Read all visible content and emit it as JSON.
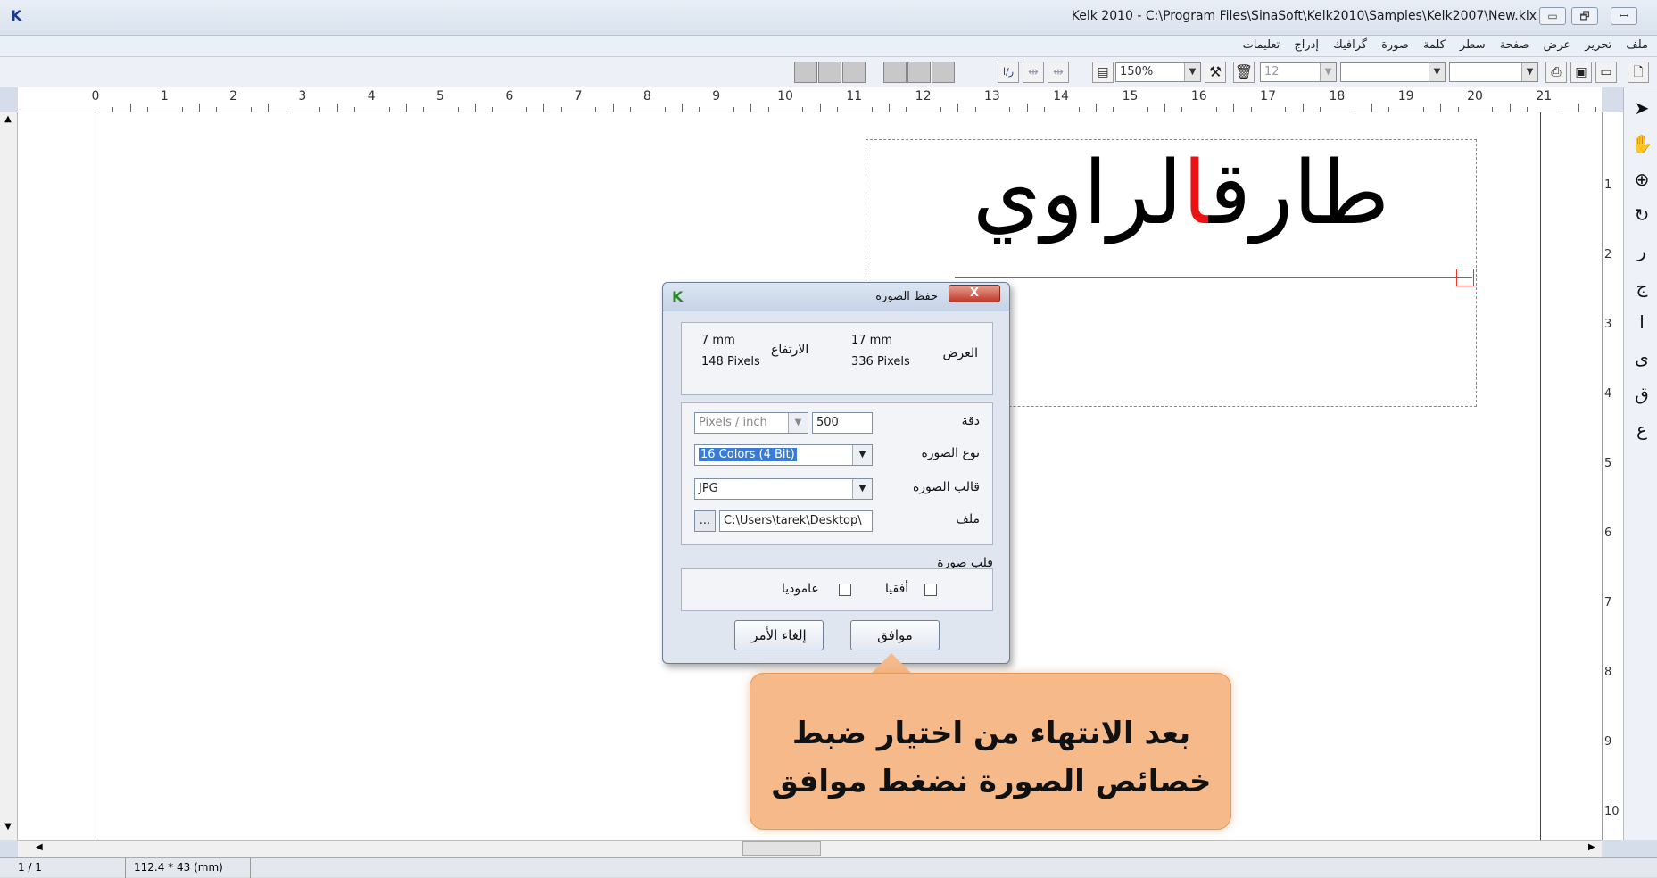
{
  "window": {
    "title": "Kelk 2010 - C:\\Program Files\\SinaSoft\\Kelk2010\\Samples\\Kelk2007\\New.klx",
    "logo": "K",
    "minimize": "▭",
    "restore": "🗗",
    "close": "ꟷ"
  },
  "menu": [
    "ملف",
    "تحرير",
    "عرض",
    "صفحة",
    "سطر",
    "كلمة",
    "صورة",
    "گرافيك",
    "إدراج",
    "تعليمات"
  ],
  "toolbar": {
    "zoom": "150%",
    "font_size": "12",
    "font_name": "",
    "style_name": "",
    "page": "",
    "direction_label": "ر/ا"
  },
  "ruler": {
    "h_numbers": [
      "0",
      "1",
      "2",
      "3",
      "4",
      "5",
      "6",
      "7",
      "8",
      "9",
      "10",
      "11",
      "12",
      "13",
      "14",
      "15",
      "16",
      "17",
      "18",
      "19",
      "20",
      "21"
    ],
    "v_numbers": [
      "1",
      "2",
      "3",
      "4",
      "5",
      "6",
      "7",
      "8",
      "9",
      "10"
    ]
  },
  "canvas": {
    "calligraphy_black_left": "طارق",
    "calligraphy_red": "ا",
    "calligraphy_black_right": "لراوي"
  },
  "statusbar": {
    "page": "1 / 1",
    "size": "112.4 * 43 (mm)"
  },
  "dialog": {
    "title": "حفظ الصورة",
    "width_label": "العرض",
    "width_mm": "17 mm",
    "width_px": "336 Pixels",
    "height_label": "الارتفاع",
    "height_mm": "7 mm",
    "height_px": "148 Pixels",
    "resolution_label": "دقة",
    "resolution_unit": "Pixels / inch",
    "resolution_value": "500",
    "image_type_label": "نوع الصورة",
    "image_type_value": "16 Colors (4 Bit)",
    "image_format_label": "قالب الصورة",
    "image_format_value": "JPG",
    "file_label": "ملف",
    "file_value": "C:\\Users\\tarek\\Desktop\\",
    "browse": "...",
    "flip_label": "قلب صورة",
    "flip_h": "أفقيا",
    "flip_v": "عاموديا",
    "ok": "موافق",
    "cancel": "إلغاء الأمر",
    "close": "X"
  },
  "callout": {
    "line1": "بعد الانتهاء من اختيار ضبط",
    "line2": "خصائص الصورة نضغط موافق"
  }
}
